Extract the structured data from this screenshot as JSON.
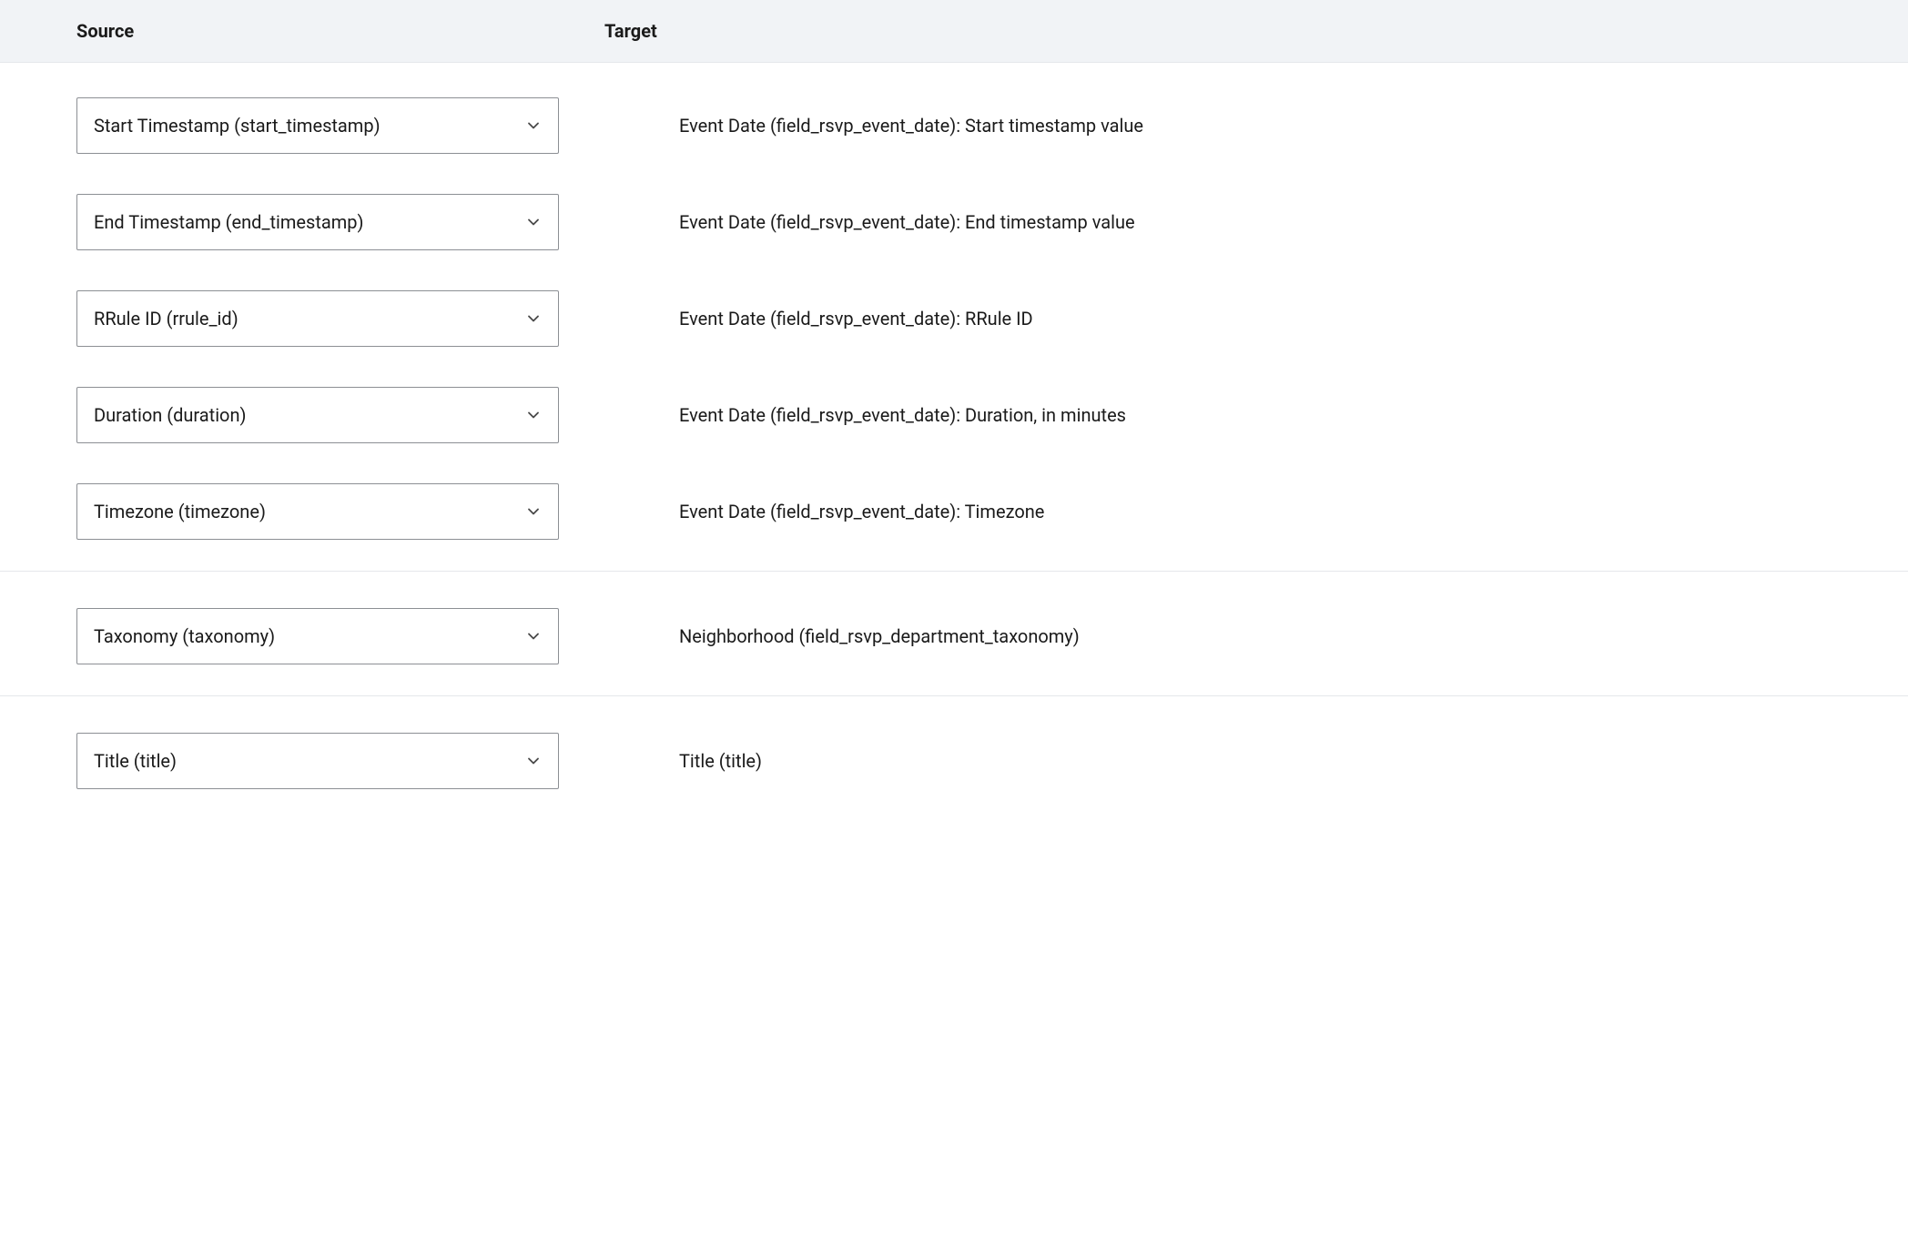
{
  "header": {
    "source_label": "Source",
    "target_label": "Target"
  },
  "groups": [
    {
      "rows": [
        {
          "source": "Start Timestamp (start_timestamp)",
          "target": "Event Date (field_rsvp_event_date): Start timestamp value"
        },
        {
          "source": "End Timestamp (end_timestamp)",
          "target": "Event Date (field_rsvp_event_date): End timestamp value"
        },
        {
          "source": "RRule ID (rrule_id)",
          "target": "Event Date (field_rsvp_event_date): RRule ID"
        },
        {
          "source": "Duration (duration)",
          "target": "Event Date (field_rsvp_event_date): Duration, in minutes"
        },
        {
          "source": "Timezone (timezone)",
          "target": "Event Date (field_rsvp_event_date): Timezone"
        }
      ]
    },
    {
      "rows": [
        {
          "source": "Taxonomy (taxonomy)",
          "target": "Neighborhood (field_rsvp_department_taxonomy)"
        }
      ]
    },
    {
      "rows": [
        {
          "source": "Title (title)",
          "target": "Title (title)"
        }
      ]
    }
  ]
}
